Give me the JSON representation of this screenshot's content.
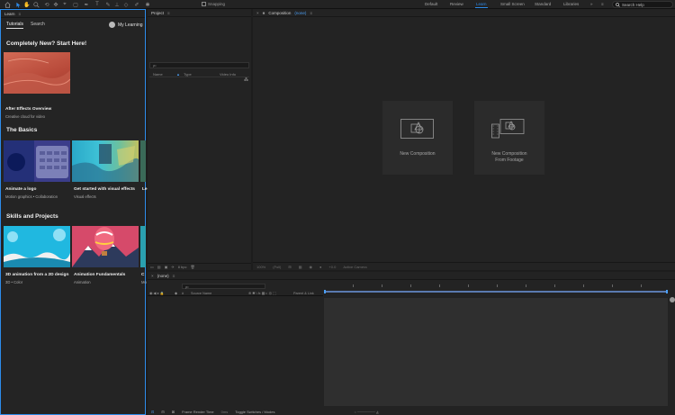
{
  "toolbar": {
    "tools": [
      "home-icon",
      "selection-icon",
      "hand-icon",
      "zoom-icon",
      "rotate-icon",
      "camera-orbit-icon",
      "pan-behind-icon",
      "mask-icon",
      "pen-icon",
      "type-icon",
      "brush-icon",
      "clone-stamp-icon",
      "eraser-icon",
      "roto-brush-icon",
      "puppet-pin-icon"
    ],
    "snapping_label": "Snapping",
    "workspaces": [
      "Default",
      "Review",
      "Learn",
      "Small Screen",
      "Standard",
      "Libraries"
    ],
    "active_workspace": "Learn",
    "search_label": "Search Help"
  },
  "learn": {
    "title": "Learn",
    "tab_tutorials": "Tutorials",
    "tab_search": "Search",
    "my_learning": "My Learning",
    "section1": "Completely New? Start Here!",
    "card1_title": "After Effects Overview",
    "card1_sub": "Creative cloud for video",
    "section2": "The Basics",
    "card2_title": "Animate a logo",
    "card2_sub": "Motion graphics  •  Collaboration",
    "card3_title": "Get started with visual effects",
    "card3_sub": "Visual effects",
    "card4_title": "Le",
    "section3": "Skills and Projects",
    "card5_title": "3D animation from a 2D design",
    "card5_sub": "3D  •  Color",
    "card6_title": "Animation Fundamentals",
    "card6_sub": "Animation",
    "card7_title": "C",
    "card7_sub": "Mo"
  },
  "project": {
    "title": "Project",
    "search_placeholder": "ρ•",
    "col_name": "Name",
    "col_type": "Type",
    "col_video": "Video Info",
    "bpc": "8 bpc"
  },
  "composition": {
    "title": "Composition",
    "comp_name": "(none)",
    "card_new": "New Composition",
    "card_footage_1": "New Composition",
    "card_footage_2": "From Footage",
    "footer": [
      "100%",
      "(Full)",
      "+0.0",
      "Active Camera"
    ]
  },
  "timeline": {
    "title": "(none)",
    "search_placeholder": "ρ•",
    "col_hash": "#",
    "col_source": "Source Name",
    "col_parent": "Parent & Link",
    "footer_render": "Frame Render Time",
    "footer_render_val": "0ms",
    "footer_toggle": "Toggle Switches / Modes"
  }
}
